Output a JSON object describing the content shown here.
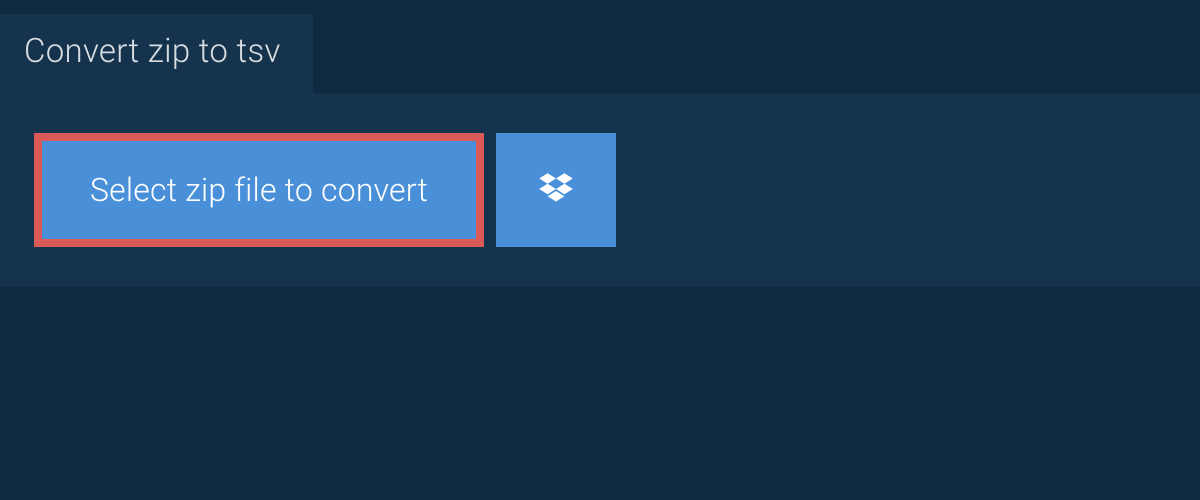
{
  "tab": {
    "title": "Convert zip to tsv"
  },
  "actions": {
    "select_file_label": "Select zip file to convert",
    "dropbox_icon_name": "dropbox-icon"
  },
  "colors": {
    "background": "#0f2940",
    "panel": "#16334d",
    "button": "#4990d8",
    "highlight_border": "#db5a57",
    "text_light": "#ffffff",
    "tab_text": "#d8dde2"
  }
}
